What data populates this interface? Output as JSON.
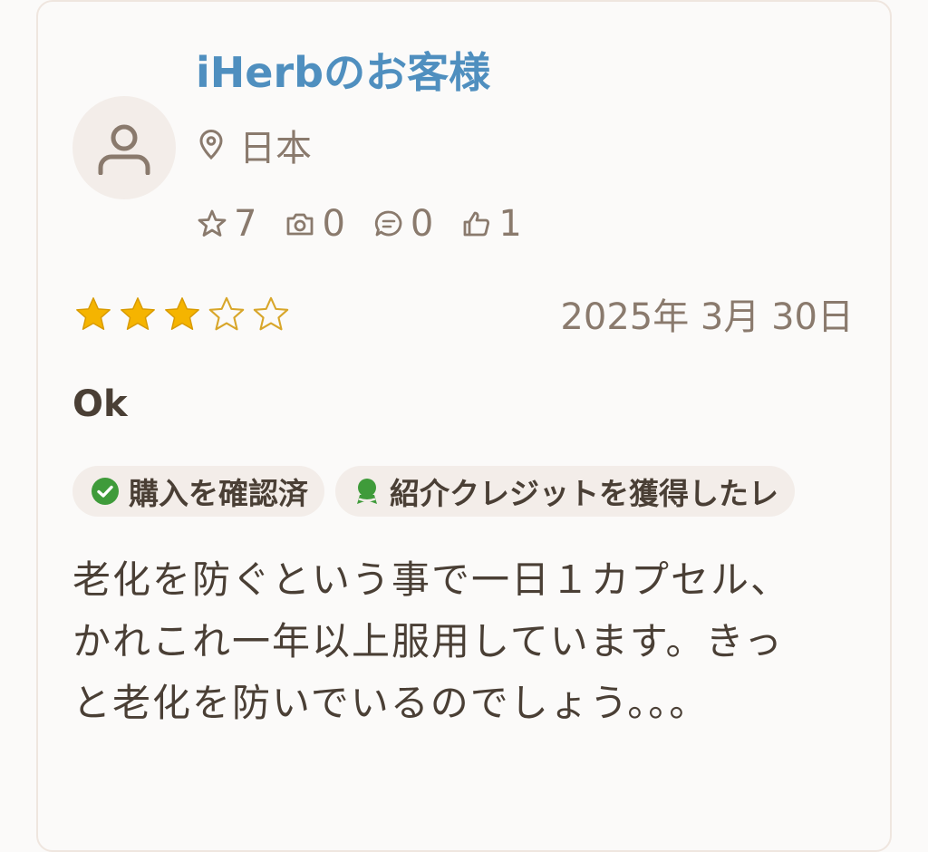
{
  "review": {
    "author": "iHerbのお客様",
    "location": "日本",
    "stats": {
      "ratings": "7",
      "photos": "0",
      "comments": "0",
      "likes": "1"
    },
    "rating": 3,
    "rating_max": 5,
    "date": "2025年 3月 30日",
    "title": "Ok",
    "badges": {
      "verified": "購入を確認済",
      "rewarded": "紹介クレジットを獲得したレ"
    },
    "body": "老化を防ぐという事で一日１カプセル、かれこれ一年以上服用しています。きっと老化を防いでいるのでしょう。。。"
  },
  "colors": {
    "name": "#4f8fbf",
    "muted": "#8a7a6d",
    "text": "#4a3f35",
    "star": "#f5b400",
    "check": "#3f9b3a",
    "badge_bg": "#f3ede9"
  },
  "icons": {
    "avatar": "user-icon",
    "location": "map-pin-icon",
    "ratings": "star-outline-icon",
    "photos": "camera-icon",
    "comments": "chat-bubble-icon",
    "likes": "thumbs-up-icon",
    "verified": "check-circle-icon",
    "rewarded": "award-ribbon-icon"
  }
}
